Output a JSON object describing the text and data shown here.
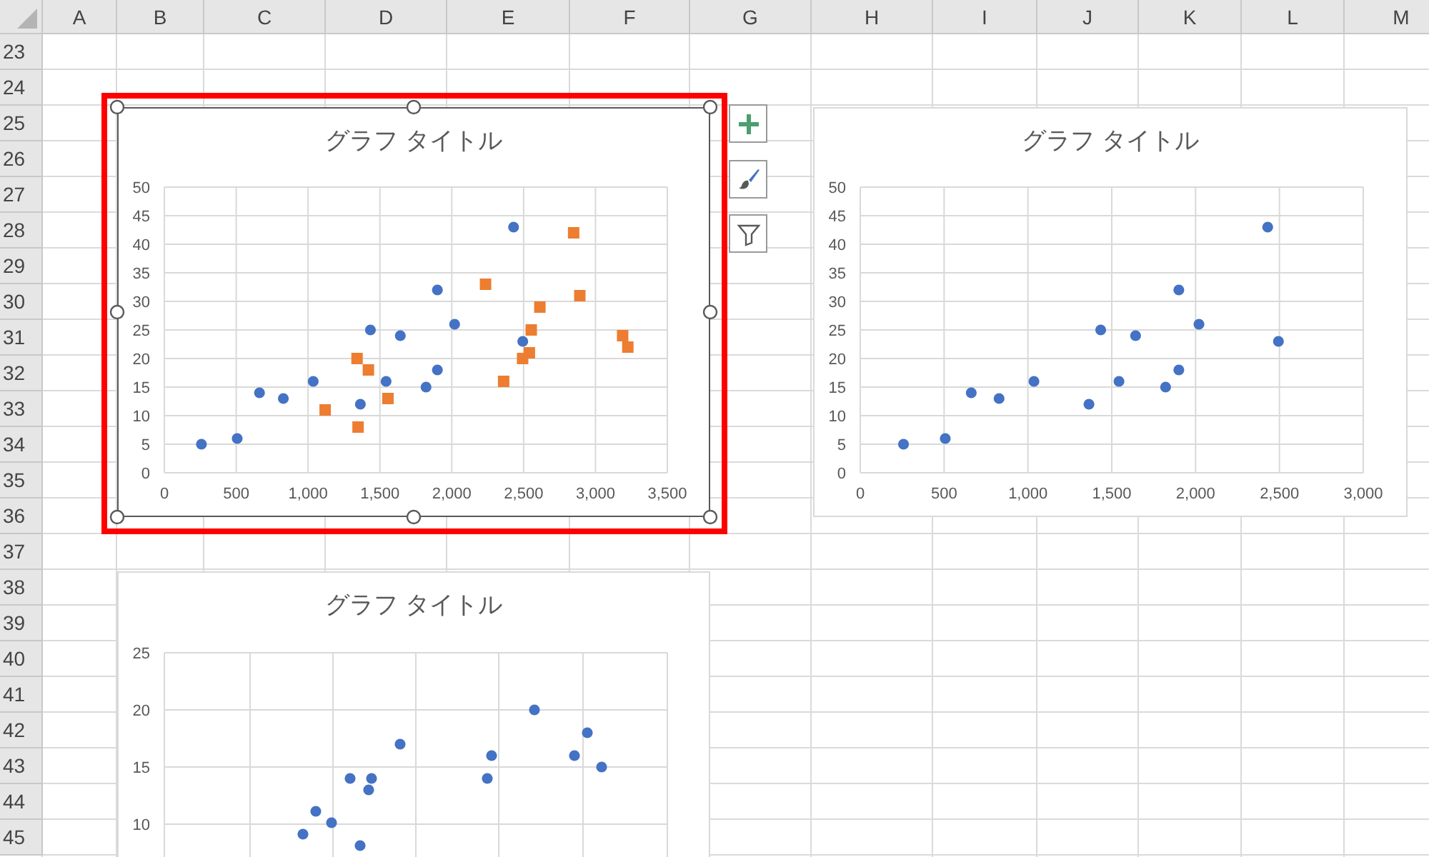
{
  "sheet": {
    "column_headers": [
      "A",
      "B",
      "C",
      "D",
      "E",
      "F",
      "G",
      "H",
      "I",
      "J",
      "K",
      "L",
      "M"
    ],
    "row_headers": [
      "23",
      "24",
      "25",
      "26",
      "27",
      "28",
      "29",
      "30",
      "31",
      "32",
      "33",
      "34",
      "35",
      "36",
      "37",
      "38",
      "39",
      "40",
      "41",
      "42",
      "43",
      "44",
      "45"
    ]
  },
  "charts": [
    {
      "kind": "scatter",
      "title": "グラフ タイトル",
      "selected": true,
      "chart_data": {
        "type": "scatter",
        "grid": true,
        "xlim": [
          0,
          3500
        ],
        "ylim": [
          0,
          50
        ],
        "xticks": [
          {
            "value": 0,
            "label": "0"
          },
          {
            "value": 500,
            "label": "500"
          },
          {
            "value": 1000,
            "label": "1,000"
          },
          {
            "value": 1500,
            "label": "1,500"
          },
          {
            "value": 2000,
            "label": "2,000"
          },
          {
            "value": 2500,
            "label": "2,500"
          },
          {
            "value": 3000,
            "label": "3,000"
          },
          {
            "value": 3500,
            "label": "3,500"
          }
        ],
        "yticks": [
          0,
          5,
          10,
          15,
          20,
          25,
          30,
          35,
          40,
          45,
          50
        ],
        "series": [
          {
            "color": "#4472c4",
            "x": [
              258,
              507,
              662,
              828,
              1036,
              1364,
              1434,
              1543,
              1642,
              1821,
              1900,
              1900,
              2020,
              2430,
              2494
            ],
            "values": [
              5,
              6,
              14,
              13,
              16,
              12,
              25,
              16,
              24,
              15,
              32,
              18,
              26,
              43,
              23
            ]
          },
          {
            "color": "#ed7d31",
            "x": [
              1119,
              1341,
              1348,
              1420,
              1556,
              2235,
              2361,
              2493,
              2540,
              2553,
              2613,
              2848,
              2891,
              3189,
              3225
            ],
            "values": [
              11,
              20,
              8,
              18,
              13,
              33,
              16,
              20,
              21,
              25,
              29,
              42,
              31,
              24,
              22
            ]
          }
        ]
      }
    },
    {
      "kind": "scatter",
      "title": "グラフ タイトル",
      "selected": false,
      "chart_data": {
        "type": "scatter",
        "grid": true,
        "xlim": [
          0,
          3000
        ],
        "ylim": [
          0,
          50
        ],
        "xticks": [
          {
            "value": 0,
            "label": "0"
          },
          {
            "value": 500,
            "label": "500"
          },
          {
            "value": 1000,
            "label": "1,000"
          },
          {
            "value": 1500,
            "label": "1,500"
          },
          {
            "value": 2000,
            "label": "2,000"
          },
          {
            "value": 2500,
            "label": "2,500"
          },
          {
            "value": 3000,
            "label": "3,000"
          }
        ],
        "yticks": [
          0,
          5,
          10,
          15,
          20,
          25,
          30,
          35,
          40,
          45,
          50
        ],
        "series": [
          {
            "color": "#4472c4",
            "x": [
              258,
              507,
              662,
              828,
              1036,
              1364,
              1434,
              1543,
              1642,
              1821,
              1900,
              1900,
              2020,
              2430,
              2494
            ],
            "values": [
              5,
              6,
              14,
              13,
              16,
              12,
              25,
              16,
              24,
              15,
              32,
              18,
              26,
              43,
              23
            ]
          }
        ]
      }
    },
    {
      "kind": "picture",
      "title": "グラフ タイトル",
      "selected": false,
      "y_axis_labels": [
        "25",
        "20",
        "15",
        "10"
      ]
    }
  ]
}
